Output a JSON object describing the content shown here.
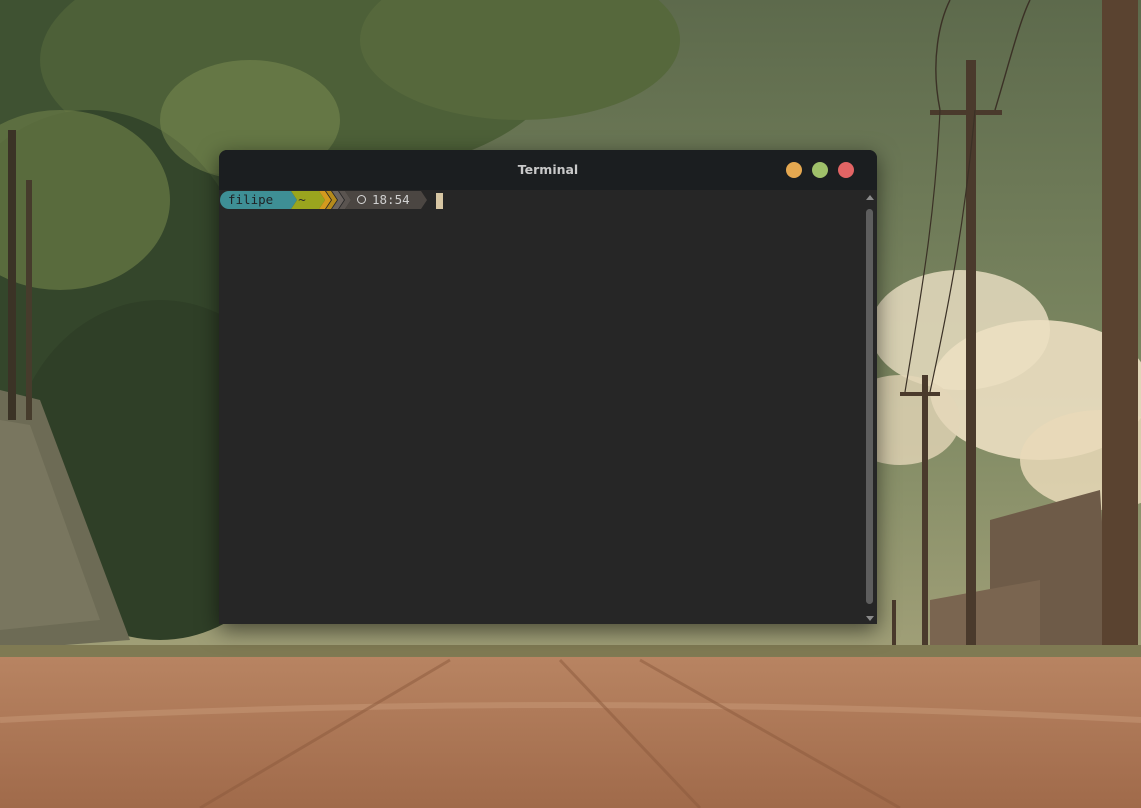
{
  "window": {
    "title": "Terminal",
    "buttons": {
      "minimize_color": "#e5a850",
      "maximize_color": "#9fc06a",
      "close_color": "#e26464"
    }
  },
  "prompt": {
    "user": "filipe",
    "directory": "~",
    "time": "18:54",
    "clock_icon": "clock-icon",
    "colors": {
      "user_bg": "#3e8f95",
      "dir_bg": "#9aa51e",
      "dir_arrow": "#d39a1e",
      "time_bg": "#4b4642",
      "cursor": "#d7c6a3"
    }
  },
  "terminal": {
    "background": "#262626",
    "scroll_position": 1.0
  }
}
